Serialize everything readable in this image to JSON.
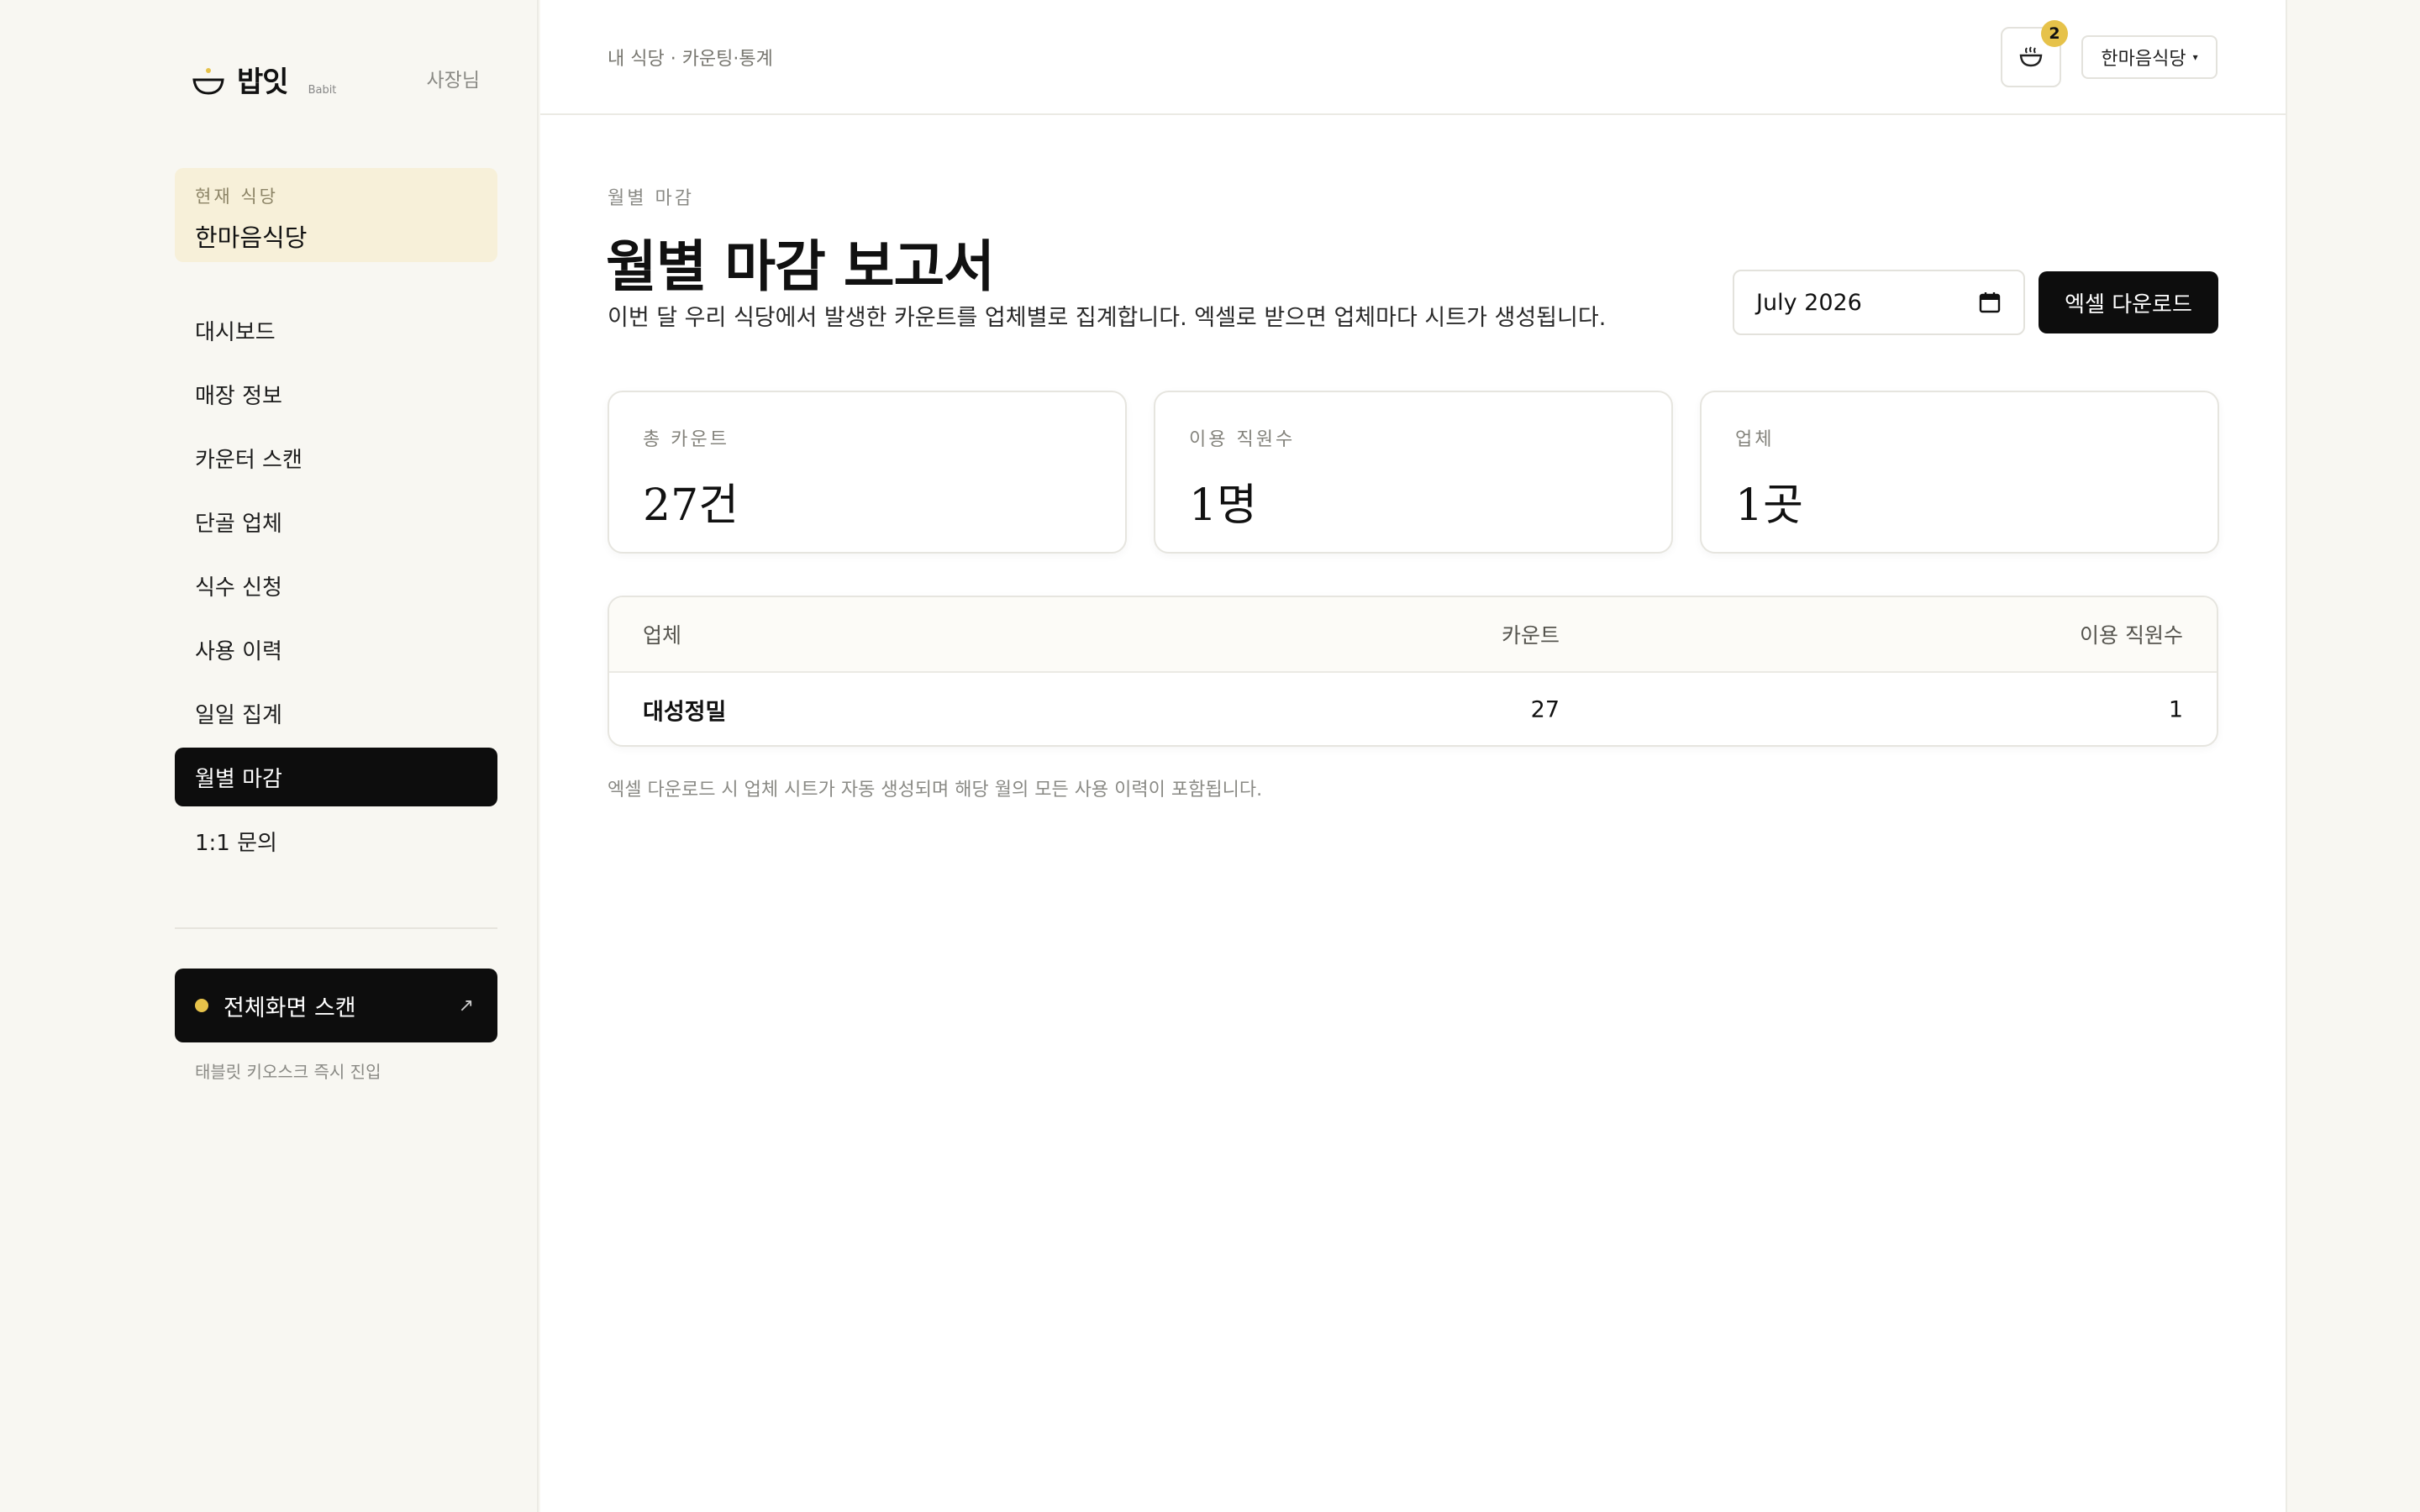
{
  "sidebar": {
    "brand_name": "밥잇",
    "brand_sub": "Babit",
    "role": "사장님",
    "current_label": "현재 식당",
    "current_name": "한마음식당",
    "items": [
      {
        "label": "대시보드"
      },
      {
        "label": "매장 정보"
      },
      {
        "label": "카운터 스캔"
      },
      {
        "label": "단골 업체"
      },
      {
        "label": "식수 신청"
      },
      {
        "label": "사용 이력"
      },
      {
        "label": "일일 집계"
      },
      {
        "label": "월별 마감",
        "active": true
      },
      {
        "label": "1:1 문의"
      }
    ],
    "fullscreen_label": "전체화면 스캔",
    "fullscreen_arrow": "↗",
    "kiosk_hint": "태블릿 키오스크 즉시 진입"
  },
  "header": {
    "breadcrumb": "내 식당 · 카운팅·통계",
    "notification_count": "2",
    "store_select": "한마음식당",
    "store_caret": "▾"
  },
  "page": {
    "eyebrow": "월별 마감",
    "title": "월별 마감 보고서",
    "description": "이번 달 우리 식당에서 발생한 카운트를 업체별로 집계합니다. 엑셀로 받으면 업체마다 시트가 생성됩니다.",
    "month_value": "July  2026",
    "excel_button": "엑셀 다운로드"
  },
  "stats": [
    {
      "label": "총 카운트",
      "value": "27건"
    },
    {
      "label": "이용 직원수",
      "value": "1명"
    },
    {
      "label": "업체",
      "value": "1곳"
    }
  ],
  "table": {
    "headers": [
      "업체",
      "카운트",
      "이용 직원수"
    ],
    "rows": [
      [
        "대성정밀",
        "27",
        "1"
      ]
    ]
  },
  "footnote": "엑셀 다운로드 시 업체 시트가 자동 생성되며 해당 월의 모든 사용 이력이 포함됩니다.",
  "colors": {
    "accent": "#e6c24a",
    "dark": "#0d0d0d",
    "current_card_bg": "#f7f0d9"
  }
}
